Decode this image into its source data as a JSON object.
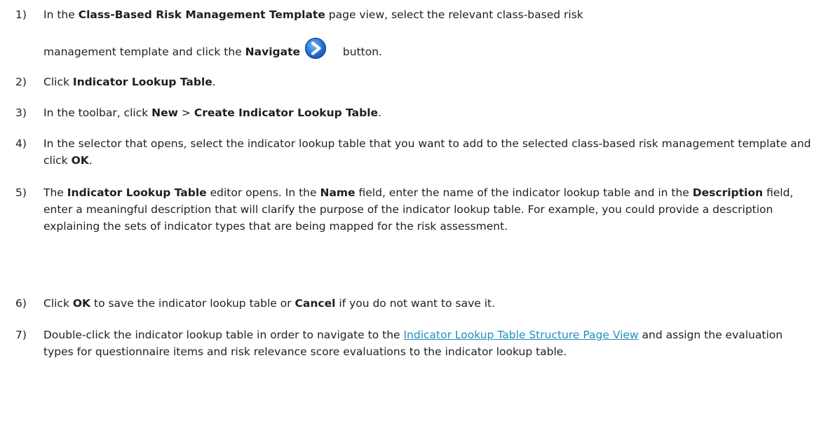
{
  "steps": [
    {
      "number": "1)",
      "line1_a": "In the ",
      "line1_b": "Class-Based Risk Management Template",
      "line1_c": " page view, select the relevant class-based risk",
      "line2_a": "management template and click the ",
      "line2_b": "Navigate",
      "line2_c": " button.",
      "icon": "navigate-arrow-icon"
    },
    {
      "number": "2)",
      "a": "Click ",
      "b": "Indicator Lookup Table",
      "c": "."
    },
    {
      "number": "3)",
      "a": "In the toolbar, click ",
      "b": "New",
      "c": " > ",
      "d": "Create Indicator Lookup Table",
      "e": "."
    },
    {
      "number": "4)",
      "a": "In the selector that opens, select the indicator lookup table that you want to add to the selected class-based risk management template and click ",
      "b": "OK",
      "c": "."
    },
    {
      "number": "5)",
      "a": "The ",
      "b": "Indicator Lookup Table",
      "c": " editor opens. In the ",
      "d": "Name",
      "e": " field, enter the name of the indicator lookup table and in the ",
      "f": "Description",
      "g": " field, enter a meaningful description that will clarify the purpose of the indicator lookup table. For example, you could provide a description explaining the sets of indicator types that are being mapped for the risk assessment."
    },
    {
      "number": "6)",
      "a": "Click ",
      "b": "OK",
      "c": " to save the indicator lookup table or ",
      "d": "Cancel",
      "e": " if you do not want to save it."
    },
    {
      "number": "7)",
      "a": "Double-click the indicator lookup table in order to navigate to the ",
      "link": "Indicator Lookup Table Structure Page View",
      "c": " and assign the evaluation types for questionnaire items and risk relevance score evaluations to the indicator lookup table."
    }
  ],
  "colors": {
    "text": "#1f1f1f",
    "link": "#1f8fc0",
    "icon_fill": "#1e6fd0"
  }
}
